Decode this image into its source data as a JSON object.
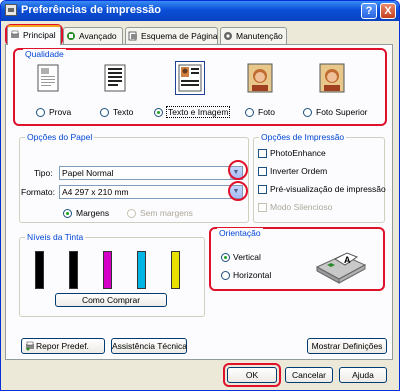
{
  "window": {
    "title": "Preferências de impressão"
  },
  "titlebar": {
    "help_label": "?",
    "close_label": "X"
  },
  "tabs": [
    {
      "label": "Principal",
      "active": true
    },
    {
      "label": "Avançado",
      "active": false
    },
    {
      "label": "Esquema de Página",
      "active": false
    },
    {
      "label": "Manutenção",
      "active": false
    }
  ],
  "qualidade": {
    "title": "Qualidade",
    "options": [
      {
        "label": "Prova",
        "selected": false
      },
      {
        "label": "Texto",
        "selected": false
      },
      {
        "label": "Texto e Imagem",
        "selected": true
      },
      {
        "label": "Foto",
        "selected": false
      },
      {
        "label": "Foto Superior",
        "selected": false
      }
    ]
  },
  "opcoes_papel": {
    "title": "Opções do Papel",
    "tipo_label": "Tipo:",
    "tipo_value": "Papel Normal",
    "formato_label": "Formato:",
    "formato_value": "A4 297 x 210 mm",
    "margens_label": "Margens",
    "sem_margens_label": "Sem margens"
  },
  "opcoes_impressao": {
    "title": "Opções de Impressão",
    "items": [
      "PhotoEnhance",
      "Inverter Ordem",
      "Pré-visualização de impressão",
      "Modo Silencioso"
    ]
  },
  "niveis_tinta": {
    "title": "Níveis da Tinta",
    "colors": [
      "#000000",
      "#000000",
      "#d400c8",
      "#00b4e6",
      "#e8e000"
    ],
    "buy_button": "Como Comprar"
  },
  "orientacao": {
    "title": "Orientação",
    "vertical_label": "Vertical",
    "horizontal_label": "Horizontal",
    "selected": "Vertical"
  },
  "bottom_buttons": {
    "repor": "Repor Predef.",
    "assistencia": "Assistência Técnica",
    "mostrar": "Mostrar Definições"
  },
  "dialog_buttons": {
    "ok": "OK",
    "cancelar": "Cancelar",
    "ajuda": "Ajuda"
  },
  "colors": {
    "accent_highlight": "#e0122b",
    "group_title": "#0046d5",
    "titlebar": "#0a4fd8"
  }
}
